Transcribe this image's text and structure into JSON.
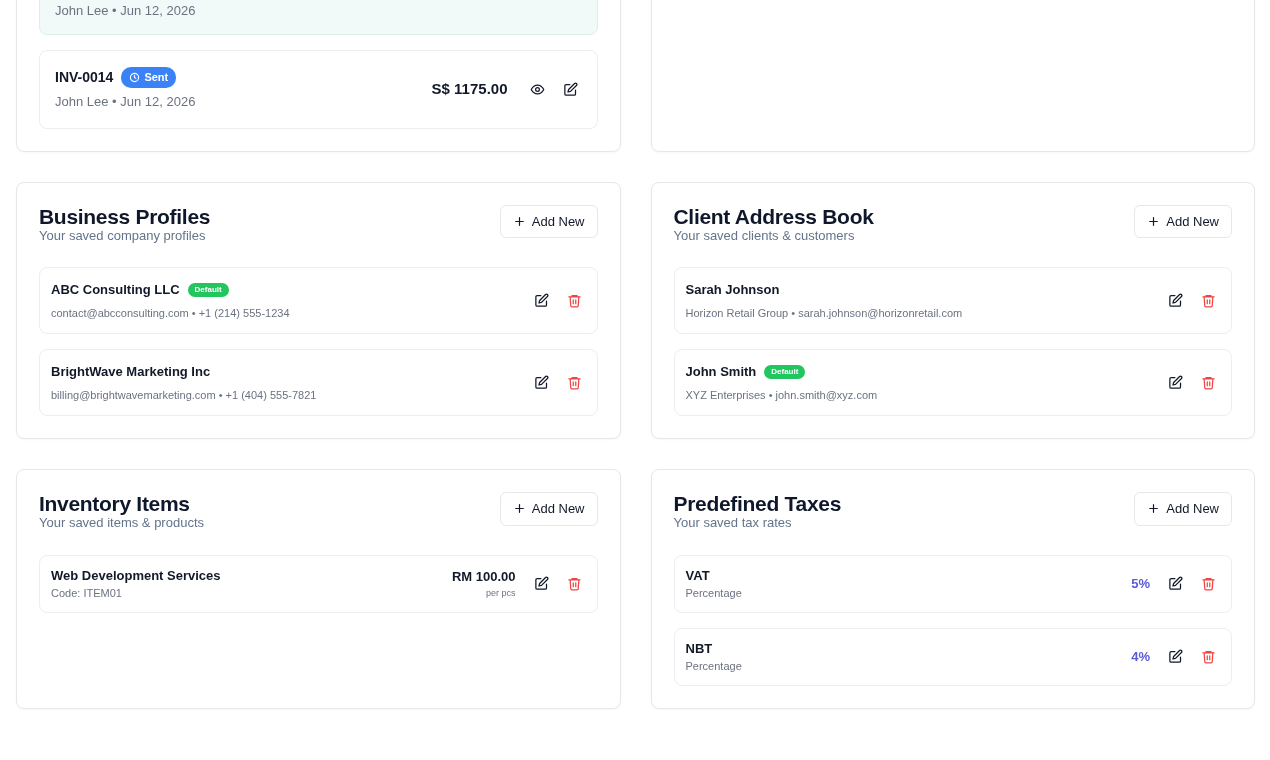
{
  "invoices": {
    "rows": [
      {
        "meta": "John Lee • Jun 12, 2026",
        "selected": true
      },
      {
        "number": "INV-0014",
        "status": {
          "label": "Sent",
          "kind": "sent"
        },
        "meta": "John Lee • Jun 12, 2026",
        "amount": "S$ 1175.00",
        "selected": false
      }
    ]
  },
  "sections": [
    {
      "title": "Business Profiles",
      "subtitle": "Your saved company profiles",
      "add_button": "Add New",
      "items": [
        {
          "kind": "contact",
          "name": "ABC Consulting LLC",
          "badge": "Default",
          "detail": "contact@abcconsulting.com • +1 (214) 555-1234"
        },
        {
          "kind": "contact",
          "name": "BrightWave Marketing Inc",
          "detail": "billing@brightwavemarketing.com • +1 (404) 555-7821"
        }
      ]
    },
    {
      "title": "Client Address Book",
      "subtitle": "Your saved clients & customers",
      "add_button": "Add New",
      "items": [
        {
          "kind": "contact",
          "name": "Sarah Johnson",
          "detail": "Horizon Retail Group • sarah.johnson@horizonretail.com"
        },
        {
          "kind": "contact",
          "name": "John Smith",
          "badge": "Default",
          "detail": "XYZ Enterprises • john.smith@xyz.com"
        }
      ]
    },
    {
      "title": "Inventory Items",
      "subtitle": "Your saved items & products",
      "add_button": "Add New",
      "items": [
        {
          "kind": "product",
          "name": "Web Development Services",
          "detail": "Code: ITEM01",
          "price": "RM 100.00",
          "unit": "per pcs"
        }
      ]
    },
    {
      "title": "Predefined Taxes",
      "subtitle": "Your saved tax rates",
      "add_button": "Add New",
      "items": [
        {
          "kind": "tax",
          "name": "VAT",
          "detail": "Percentage",
          "rate": "5%"
        },
        {
          "kind": "tax",
          "name": "NBT",
          "detail": "Percentage",
          "rate": "4%"
        }
      ]
    }
  ]
}
